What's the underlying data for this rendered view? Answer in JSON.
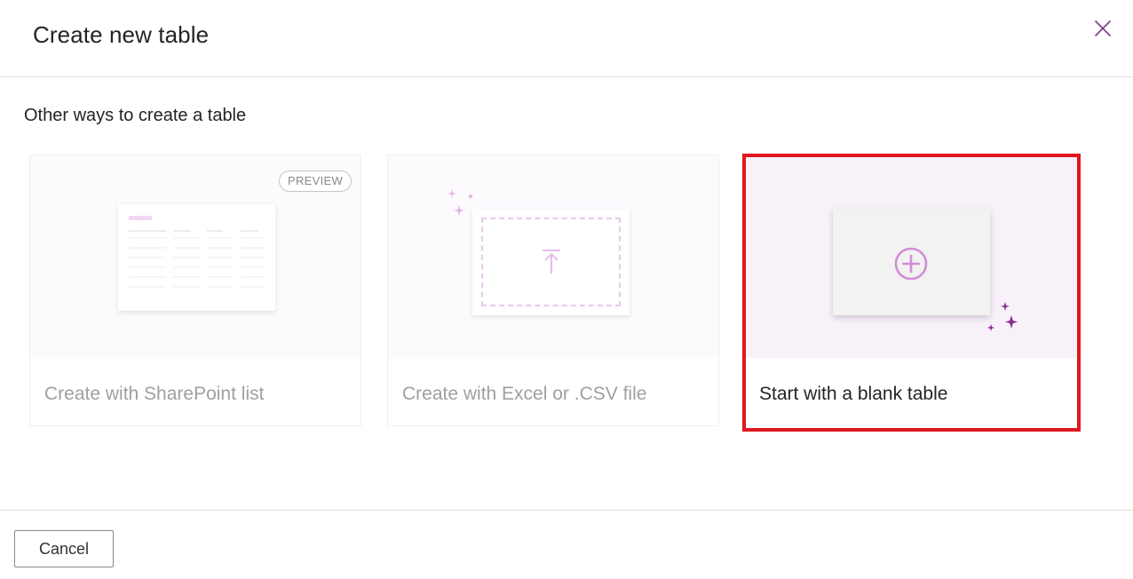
{
  "dialog": {
    "title": "Create new table",
    "close_icon": "close-icon"
  },
  "section": {
    "heading": "Other ways to create a table"
  },
  "cards": [
    {
      "label": "Create with SharePoint list",
      "badge": "PREVIEW",
      "illustration": "list-table-illustration",
      "state": "disabled"
    },
    {
      "label": "Create with Excel or .CSV file",
      "illustration": "upload-file-illustration",
      "icon": "upload-arrow-icon",
      "state": "disabled"
    },
    {
      "label": "Start with a blank table",
      "illustration": "blank-table-illustration",
      "icon": "add-circle-icon",
      "state": "highlighted"
    }
  ],
  "footer": {
    "cancel_label": "Cancel"
  },
  "colors": {
    "accent_purple": "#a94fb0",
    "highlight_border": "#e0161e",
    "disabled_text": "#a19f9d",
    "sparkle_dark": "#8a2a8f",
    "sparkle_light": "#e3b8e5"
  }
}
